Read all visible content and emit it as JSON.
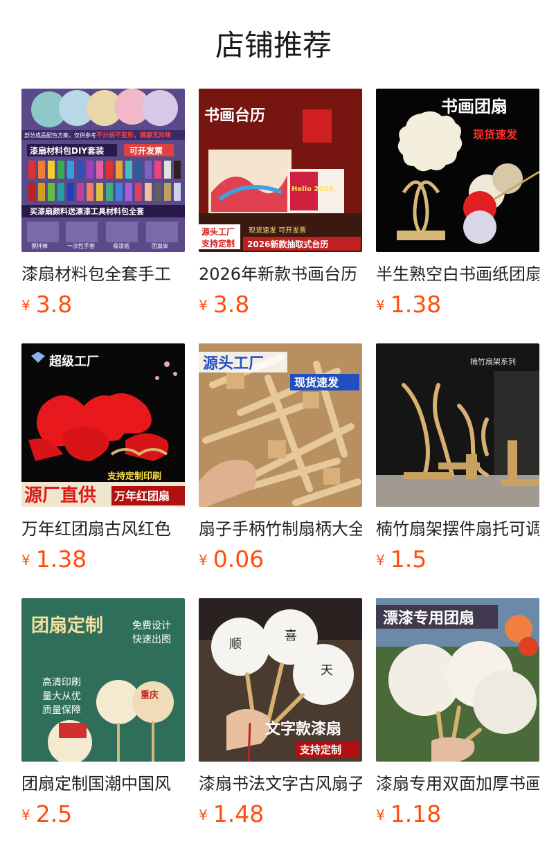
{
  "title": "店铺推荐",
  "currency_symbol": "¥",
  "accent_color": "#ff4d0a",
  "products": [
    {
      "name": "漆扇材料包全套手工",
      "price": "3.8",
      "image_text": [
        "漆扇材料包DIY套装",
        "可开发票",
        "不分层不变形，健康无异味",
        "部分成品配色方案，仅供参考",
        "买漆扇颜料送漂漆工具材料包全套",
        "搅拌棒",
        "一次性手套",
        "吸漆纸",
        "团扇架"
      ]
    },
    {
      "name": "2026年新款书画台历",
      "price": "3.8",
      "image_text": [
        "书画台历",
        "源头工厂",
        "支持定制",
        "现货速发 可开发票",
        "2026新款抽取式台历",
        "Hello 2026"
      ]
    },
    {
      "name": "半生熟空白书画纸团扇",
      "price": "1.38",
      "image_text": [
        "书画团扇",
        "现货速发"
      ]
    },
    {
      "name": "万年红团扇古风红色",
      "price": "1.38",
      "image_text": [
        "超级工厂",
        "源厂直供",
        "支持定制印刷",
        "万年红团扇"
      ]
    },
    {
      "name": "扇子手柄竹制扇柄大全",
      "price": "0.06",
      "image_text": [
        "源头工厂",
        "现货速发"
      ]
    },
    {
      "name": "楠竹扇架摆件扇托可调",
      "price": "1.5",
      "image_text": [
        "楠竹扇架系列"
      ]
    },
    {
      "name": "团扇定制国潮中国风",
      "price": "2.5",
      "image_text": [
        "团扇定制",
        "免费设计",
        "快速出图",
        "高清印刷",
        "量大从优",
        "质量保障",
        "重庆"
      ]
    },
    {
      "name": "漆扇书法文字古风扇子",
      "price": "1.48",
      "image_text": [
        "文字款漆扇",
        "支持定制"
      ]
    },
    {
      "name": "漆扇专用双面加厚书画",
      "price": "1.18",
      "image_text": [
        "漂漆专用团扇"
      ]
    }
  ]
}
